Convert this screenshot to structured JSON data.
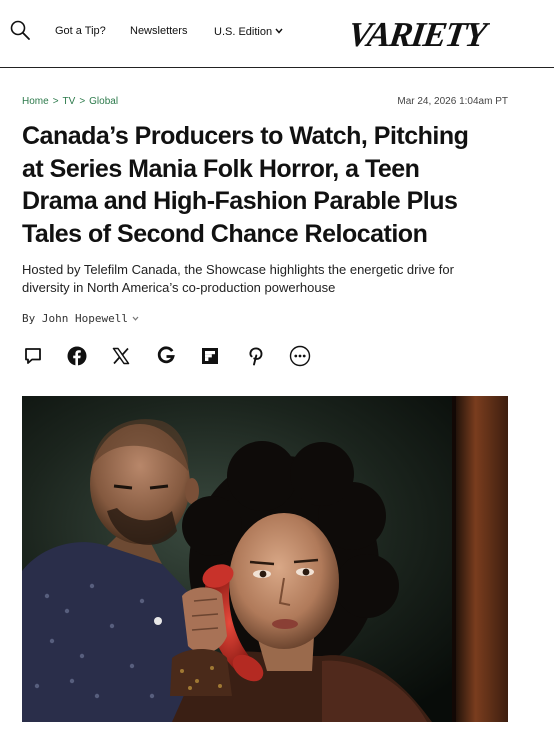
{
  "header": {
    "nav": {
      "tip": "Got a Tip?",
      "newsletters": "Newsletters",
      "edition": "U.S. Edition"
    },
    "logo_text": "VARIETY",
    "icons": [
      "search-icon",
      "chevron-down-icon"
    ]
  },
  "article": {
    "breadcrumb": [
      "Home",
      "TV",
      "Global"
    ],
    "breadcrumb_separator": ">",
    "date": "Mar 24, 2026 1:04am PT",
    "headline": {
      "line1": "Canada’s Producers to Watch, Pitching",
      "line2": "at Series Mania Folk Horror, a Teen",
      "line3": "Drama and High-Fashion Parable Plus",
      "line4": "Tales of Second Chance Relocation"
    },
    "subhead": {
      "line1": "Hosted by Telefilm Canada, the Showcase highlights the energetic drive for",
      "line2": "diversity in North America’s  co-production powerhouse"
    },
    "byline": {
      "prefix": "By",
      "author": "John Hopewell"
    },
    "share_icons": [
      "comment-icon",
      "facebook-icon",
      "x-icon",
      "google-icon",
      "flipboard-icon",
      "pinterest-icon",
      "more-icon"
    ],
    "hero_image": "photo-man-and-woman-with-red-telephone"
  },
  "colors": {
    "breadcrumb_green": "#2c7a4b",
    "telephone_red": "#c8322a",
    "text": "#111111"
  }
}
